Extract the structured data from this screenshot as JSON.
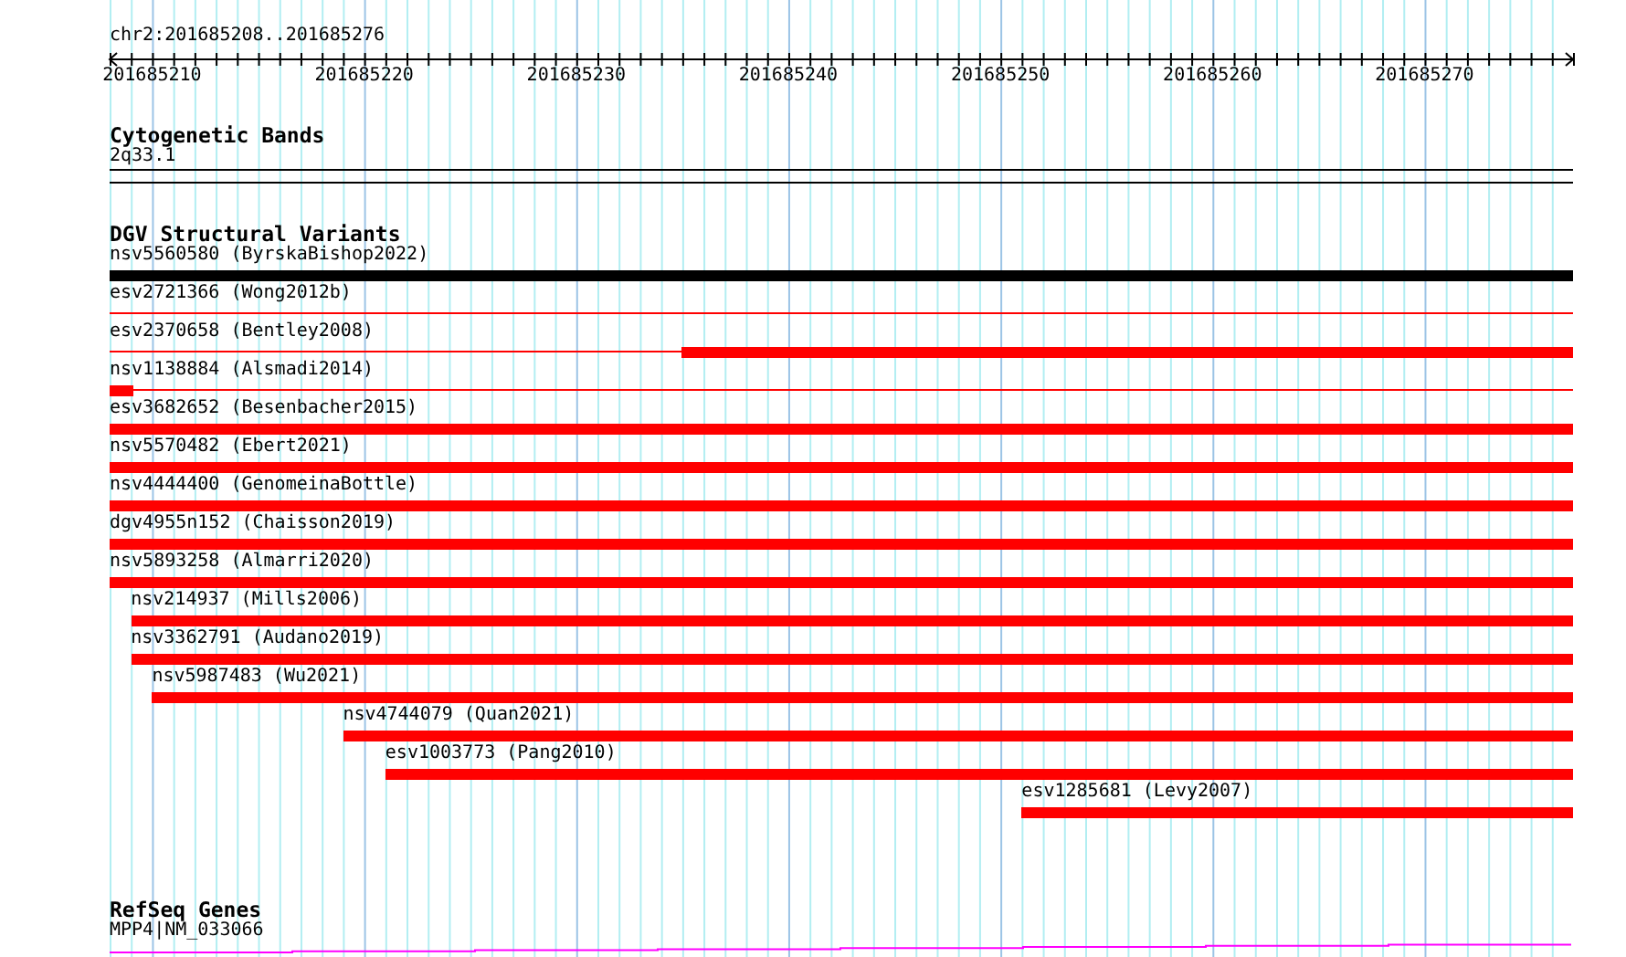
{
  "location": "chr2:201685208..201685276",
  "ruler": {
    "ticks": [
      "201685210",
      "201685220",
      "201685230",
      "201685240",
      "201685250",
      "201685260",
      "201685270"
    ]
  },
  "tracks": [
    {
      "kind": "band",
      "title": "Cytogenetic Bands",
      "features": [
        {
          "label": "2q33.1"
        }
      ]
    },
    {
      "kind": "variants",
      "title": "DGV Structural Variants",
      "features": [
        {
          "label": "nsv5560580 (ByrskaBishop2022)",
          "color": "#000000",
          "segments": [
            {
              "kind": "thick"
            }
          ]
        },
        {
          "label": "esv2721366 (Wong2012b)",
          "color": "#ff0000",
          "segments": [
            {
              "kind": "thin"
            }
          ]
        },
        {
          "label": "esv2370658 (Bentley2008)",
          "color": "#ff0000",
          "segments": [
            {
              "kind": "thin"
            },
            {
              "kind": "thick"
            }
          ]
        },
        {
          "label": "nsv1138884 (Alsmadi2014)",
          "color": "#ff0000",
          "segments": [
            {
              "kind": "thick"
            },
            {
              "kind": "thin"
            }
          ]
        },
        {
          "label": "esv3682652 (Besenbacher2015)",
          "color": "#ff0000",
          "segments": [
            {
              "kind": "thick"
            }
          ]
        },
        {
          "label": "nsv5570482 (Ebert2021)",
          "color": "#ff0000",
          "segments": [
            {
              "kind": "thick"
            }
          ]
        },
        {
          "label": "nsv4444400 (GenomeinaBottle)",
          "color": "#ff0000",
          "segments": [
            {
              "kind": "thick"
            }
          ]
        },
        {
          "label": "dgv4955n152 (Chaisson2019)",
          "color": "#ff0000",
          "segments": [
            {
              "kind": "thick"
            }
          ]
        },
        {
          "label": "nsv5893258 (Almarri2020)",
          "color": "#ff0000",
          "segments": [
            {
              "kind": "thick"
            }
          ]
        },
        {
          "label": "nsv214937 (Mills2006)",
          "color": "#ff0000",
          "segments": [
            {
              "kind": "thick"
            }
          ]
        },
        {
          "label": "nsv3362791 (Audano2019)",
          "color": "#ff0000",
          "segments": [
            {
              "kind": "thick"
            }
          ]
        },
        {
          "label": "nsv5987483 (Wu2021)",
          "color": "#ff0000",
          "segments": [
            {
              "kind": "thick"
            }
          ]
        },
        {
          "label": "nsv4744079 (Quan2021)",
          "color": "#ff0000",
          "segments": [
            {
              "kind": "thick"
            }
          ]
        },
        {
          "label": "esv1003773 (Pang2010)",
          "color": "#ff0000",
          "segments": [
            {
              "kind": "thick"
            }
          ]
        },
        {
          "label": "esv1285681 (Levy2007)",
          "color": "#ff0000",
          "segments": [
            {
              "kind": "thick"
            }
          ]
        }
      ]
    },
    {
      "kind": "gene",
      "title": "RefSeq Genes",
      "features": [
        {
          "label": "MPP4|NM_033066"
        }
      ]
    }
  ]
}
